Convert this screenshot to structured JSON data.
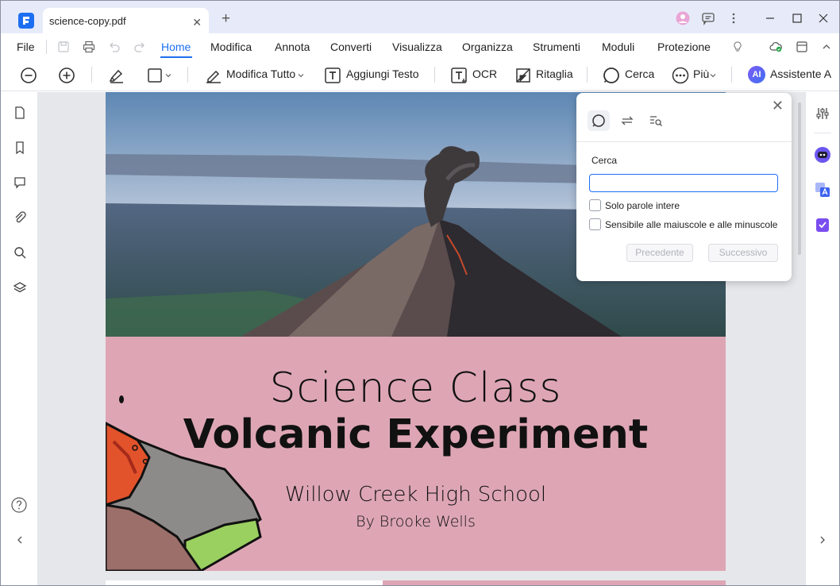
{
  "tab": {
    "title": "science-copy.pdf",
    "close": "✕",
    "new_tab": "+"
  },
  "menu": {
    "file": "File",
    "items": [
      "Home",
      "Modifica",
      "Annota",
      "Converti",
      "Visualizza",
      "Organizza",
      "Strumenti",
      "Moduli",
      "Protezione"
    ]
  },
  "toolbar": {
    "edit_all": "Modifica Tutto",
    "add_text": "Aggiungi Testo",
    "ocr": "OCR",
    "crop": "Ritaglia",
    "search": "Cerca",
    "more": "Più",
    "assistant": "Assistente A",
    "ai_badge": "AI"
  },
  "document": {
    "title_line1": "Science Class",
    "title_line2": "Volcanic Experiment",
    "school": "Willow Creek High School",
    "author": "By Brooke Wells"
  },
  "search_panel": {
    "label": "Cerca",
    "query": "",
    "whole_words": "Solo parole intere",
    "match_case": "Sensibile alle maiuscole e alle minuscole",
    "prev": "Precedente",
    "next": "Successivo",
    "close": "✕"
  },
  "colors": {
    "accent": "#1d6ff2",
    "page_pink": "#dea6b5",
    "titlebar": "#e7ebf9"
  }
}
